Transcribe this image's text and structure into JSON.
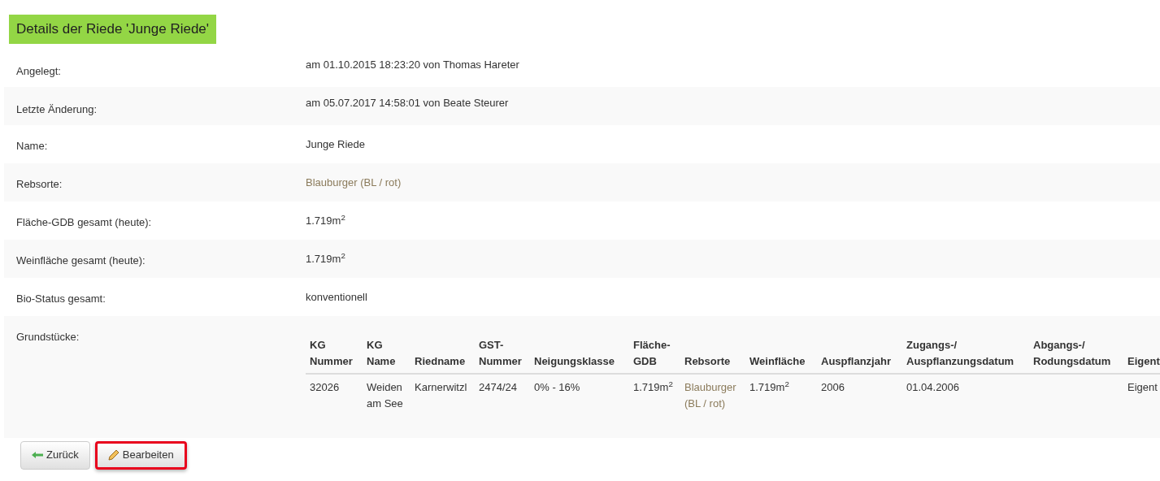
{
  "title": "Details der Riede 'Junge Riede'",
  "fields": [
    {
      "label": "Angelegt:",
      "value": "am 01.10.2015 18:23:20 von Thomas Hareter",
      "kind": "meta"
    },
    {
      "label": "Letzte Änderung:",
      "value": "am 05.07.2017 14:58:01 von Beate Steurer",
      "kind": "meta"
    },
    {
      "label": "Name:",
      "value": "Junge Riede",
      "kind": "text"
    },
    {
      "label": "Rebsorte:",
      "value": "Blauburger (BL / rot)",
      "kind": "link"
    },
    {
      "label": "Fläche-GDB gesamt (heute):",
      "value": "1.719m$^{2}$",
      "kind": "text"
    },
    {
      "label": "Weinfläche gesamt (heute):",
      "value": "1.719m$^{2}$",
      "kind": "text"
    },
    {
      "label": "Bio-Status gesamt:",
      "value": "konventionell",
      "kind": "text"
    }
  ],
  "parcels": {
    "label": "Grundstücke:",
    "columns": [
      "KG Nummer",
      "KG Name",
      "Riedname",
      "GST-Nummer",
      "Neigungsklasse",
      "Fläche-GDB",
      "Rebsorte",
      "Weinfläche",
      "Auspflanzjahr",
      "Zugangs-/ Auspflanzungsdatum",
      "Abgangs-/ Rodungsdatum",
      "Eigent"
    ],
    "rows": [
      {
        "cells": [
          {
            "text": "32026",
            "kind": "text"
          },
          {
            "text": "Weiden am See",
            "kind": "text"
          },
          {
            "text": "Karnerwitzl",
            "kind": "text"
          },
          {
            "text": "2474/24",
            "kind": "text"
          },
          {
            "text": "0% - 16%",
            "kind": "text"
          },
          {
            "text": "1.719m$^{2}$",
            "kind": "text"
          },
          {
            "text": "Blauburger (BL / rot)",
            "kind": "link"
          },
          {
            "text": "1.719m$^{2}$",
            "kind": "text"
          },
          {
            "text": "2006",
            "kind": "text"
          },
          {
            "text": "01.04.2006",
            "kind": "text"
          },
          {},
          {
            "text": "Eigent",
            "kind": "text"
          }
        ]
      }
    ]
  },
  "buttons": [
    {
      "label": "Zurück",
      "kind": "back",
      "highlighted": false
    },
    {
      "label": "Bearbeiten",
      "kind": "edit",
      "highlighted": true
    }
  ]
}
